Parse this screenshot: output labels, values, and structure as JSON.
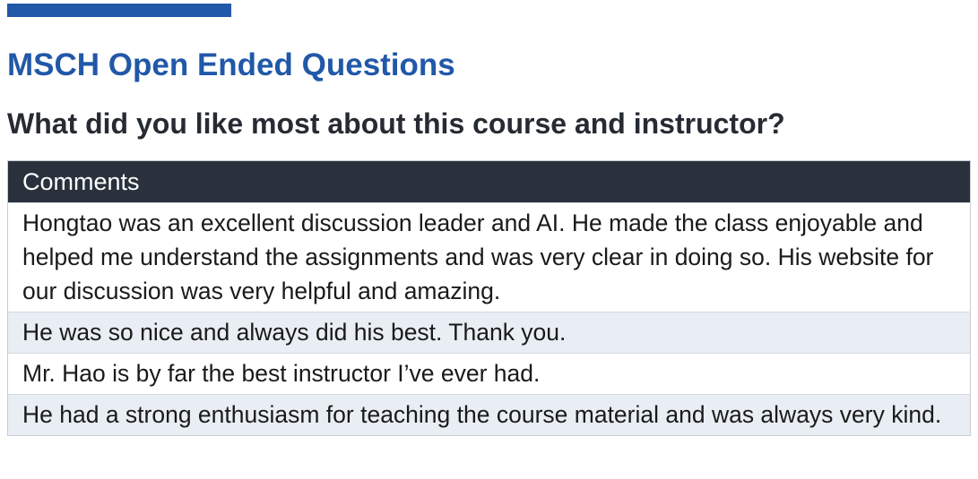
{
  "section": {
    "title": "MSCH Open Ended Questions"
  },
  "question": {
    "title": "What did you like most about this course and instructor?"
  },
  "table": {
    "header": "Comments",
    "rows": [
      "Hongtao was an excellent discussion leader and AI. He made the class enjoyable and helped me understand the assignments and was very clear in doing so. His website for our discussion was very helpful and amazing.",
      "He was so nice and always did his best. Thank you.",
      "Mr. Hao is by far the best instructor I’ve ever had.",
      "He had a strong enthusiasm for teaching the course material and was always very kind."
    ]
  },
  "colors": {
    "accent": "#2158a8",
    "header_bg": "#29313c",
    "alt_row_bg": "#e8eef3"
  }
}
